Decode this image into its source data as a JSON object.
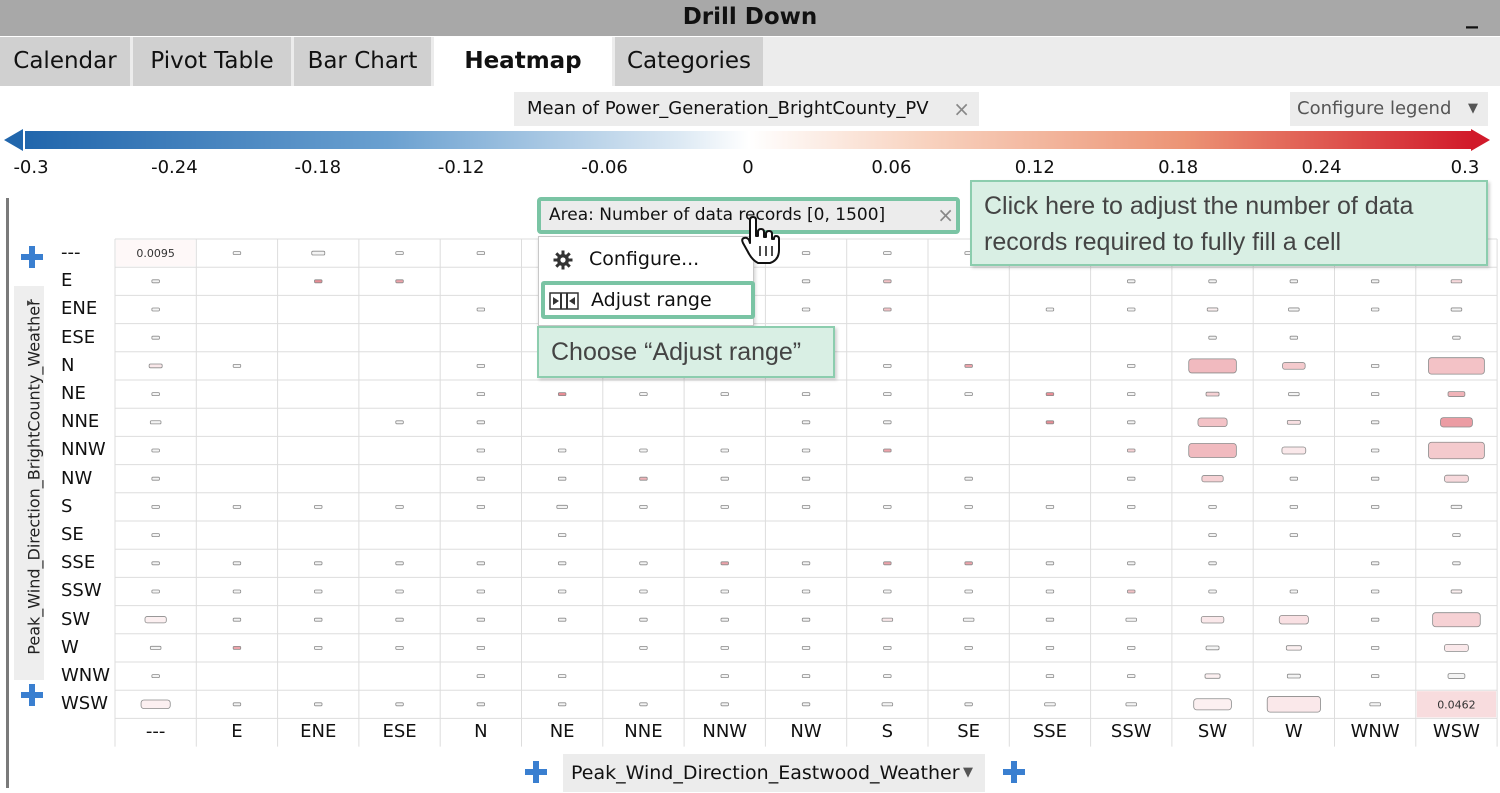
{
  "window": {
    "title": "Drill Down",
    "minimize_label": "_"
  },
  "tabs": [
    {
      "label": "Calendar",
      "active": false
    },
    {
      "label": "Pivot Table",
      "active": false
    },
    {
      "label": "Bar Chart",
      "active": false
    },
    {
      "label": "Heatmap",
      "active": true
    },
    {
      "label": "Categories",
      "active": false
    }
  ],
  "measure": {
    "label": "Mean of Power_Generation_BrightCounty_PV",
    "remove_glyph": "×"
  },
  "legend_dropdown": {
    "label": "Configure legend"
  },
  "color_scale": {
    "min": -0.3,
    "max": 0.3,
    "ticks": [
      "-0.3",
      "-0.24",
      "-0.18",
      "-0.12",
      "-0.06",
      "0",
      "0.06",
      "0.12",
      "0.18",
      "0.24",
      "0.3"
    ],
    "low_color": "#2166ac",
    "mid_color": "#ffffff",
    "high_color": "#d11a2a"
  },
  "area_encoding": {
    "label": "Area:  Number of data records  [0, 1500]",
    "remove_glyph": "×"
  },
  "context_menu": {
    "items": [
      {
        "label": "Configure...",
        "icon": "gear-icon"
      },
      {
        "label": "Adjust range",
        "icon": "adjust-range-icon"
      }
    ]
  },
  "callouts": [
    "Click here to adjust the number of data records required to fully fill a cell",
    "Choose “Adjust range”"
  ],
  "y_axis": {
    "title": "Peak_Wind_Direction_BrightCounty_Weather",
    "categories": [
      "---",
      "E",
      "ENE",
      "ESE",
      "N",
      "NE",
      "NNE",
      "NNW",
      "NW",
      "S",
      "SE",
      "SSE",
      "SSW",
      "SW",
      "W",
      "WNW",
      "WSW"
    ]
  },
  "x_axis": {
    "title": "Peak_Wind_Direction_Eastwood_Weather",
    "categories": [
      "---",
      "E",
      "ENE",
      "ESE",
      "N",
      "NE",
      "NNE",
      "NNW",
      "NW",
      "S",
      "SE",
      "SSE",
      "SSW",
      "SW",
      "W",
      "WNW",
      "WSW"
    ]
  },
  "chart_data": {
    "type": "heatmap",
    "x_categories": [
      "---",
      "E",
      "ENE",
      "ESE",
      "N",
      "NE",
      "NNE",
      "NNW",
      "NW",
      "S",
      "SE",
      "SSE",
      "SSW",
      "SW",
      "W",
      "WNW",
      "WSW"
    ],
    "y_categories": [
      "---",
      "E",
      "ENE",
      "ESE",
      "N",
      "NE",
      "NNE",
      "NNW",
      "NW",
      "S",
      "SE",
      "SSE",
      "SSW",
      "SW",
      "W",
      "WNW",
      "WSW"
    ],
    "color_range": [
      -0.3,
      0.3
    ],
    "area_range": [
      0,
      1500
    ],
    "cell_labels": [
      {
        "x": "---",
        "y": "---",
        "label": "0.0095"
      },
      {
        "x": "WSW",
        "y": "WSW",
        "label": "0.0462"
      }
    ],
    "rows": [
      [
        "f:1:0.0095",
        "d:0.01:0",
        "d:0.03:0",
        "d:0.01:0",
        "d:0.01:0",
        "",
        "",
        "",
        "d:0.01:0",
        "d:0.01:0",
        "d:0.01:0",
        "",
        "",
        "",
        "",
        "",
        ""
      ],
      [
        "d:0.01:0",
        "",
        "d:0.01:0.15",
        "d:0.01:0.12",
        "",
        "",
        "",
        "",
        "d:0.01:0",
        "d:0.01:0.08",
        "",
        "",
        "d:0.01:0",
        "d:0.01:0",
        "d:0.01:0",
        "d:0.01:0",
        "d:0.02:0.05"
      ],
      [
        "d:0.01:0",
        "",
        "",
        "",
        "d:0.01:0",
        "",
        "",
        "",
        "d:0.01:0",
        "d:0.01:0.08",
        "",
        "d:0.01:0",
        "d:0.01:0",
        "d:0.02:0.02",
        "d:0.02:0",
        "d:0.01:0",
        "d:0.02:0"
      ],
      [
        "d:0.01:0",
        "",
        "",
        "",
        "",
        "",
        "",
        "",
        "",
        "",
        "",
        "",
        "",
        "d:0.01:0",
        "d:0.01:0",
        "",
        "d:0.01:0"
      ],
      [
        "d:0.03:0.03",
        "d:0.01:0",
        "",
        "",
        "d:0.01:0",
        "",
        "",
        "",
        "d:0.01:0",
        "d:0.01:0",
        "d:0.01:0.12",
        "",
        "d:0.01:0",
        "d:0.4:0.09",
        "d:0.09:0.07",
        "d:0.01:0",
        "d:0.55:0.08"
      ],
      [
        "d:0.01:0",
        "",
        "",
        "",
        "d:0.01:0",
        "d:0.01:0.15",
        "d:0.01:0",
        "d:0.01:0",
        "d:0.01:0",
        "d:0.01:0",
        "d:0.01:0",
        "d:0.01:0.15",
        "d:0.01:0",
        "d:0.03:0.06",
        "d:0.02:0",
        "d:0.01:0",
        "d:0.05:0.1"
      ],
      [
        "d:0.02:0",
        "",
        "",
        "d:0.01:0",
        "d:0.01:0",
        "",
        "",
        "",
        "d:0.01:0",
        "d:0.01:0",
        "",
        "d:0.01:0.15",
        "d:0.01:0",
        "d:0.15:0.08",
        "d:0.03:0.04",
        "d:0.01:0",
        "d:0.18:0.13"
      ],
      [
        "d:0.01:0",
        "",
        "",
        "",
        "d:0.01:0",
        "d:0.01:0",
        "d:0.01:0",
        "d:0.01:0",
        "d:0.01:0",
        "d:0.01:0.12",
        "",
        "",
        "d:0.01:0.06",
        "d:0.4:0.09",
        "d:0.1:0.03",
        "d:0.01:0",
        "d:0.55:0.07"
      ],
      [
        "d:0.01:0",
        "",
        "",
        "",
        "d:0.01:0",
        "d:0.01:0",
        "d:0.01:0.1",
        "d:0.01:0",
        "d:0.01:0",
        "",
        "d:0.01:0",
        "",
        "d:0.01:0",
        "d:0.08:0.06",
        "d:0.01:0",
        "d:0.01:0",
        "d:0.1:0.05"
      ],
      [
        "d:0.01:0",
        "d:0.01:0",
        "d:0.01:0",
        "d:0.01:0",
        "d:0.01:0",
        "d:0.02:0",
        "d:0.01:0",
        "d:0.01:0",
        "d:0.01:0",
        "d:0.01:0",
        "d:0.01:0",
        "d:0.01:0",
        "d:0.01:0",
        "d:0.01:0",
        "d:0.01:0",
        "d:0.01:0",
        "d:0.02:0"
      ],
      [
        "d:0.01:0",
        "",
        "",
        "",
        "",
        "d:0.01:0",
        "",
        "",
        "",
        "",
        "",
        "",
        "",
        "d:0.01:0",
        "d:0.01:0",
        "",
        "d:0.01:0"
      ],
      [
        "d:0.01:0",
        "d:0.01:0",
        "d:0.01:0",
        "d:0.01:0",
        "d:0.01:0",
        "d:0.01:0",
        "d:0.01:0",
        "d:0.01:0.12",
        "d:0.01:0",
        "d:0.01:0.12",
        "d:0.01:0.12",
        "d:0.01:0",
        "d:0.01:0",
        "d:0.01:0",
        "",
        "d:0.01:0",
        "d:0.01:0"
      ],
      [
        "d:0.01:0",
        "d:0.01:0",
        "d:0.01:0",
        "d:0.01:0",
        "d:0.01:0",
        "d:0.01:0",
        "d:0.01:0",
        "d:0.01:0",
        "d:0.01:0",
        "d:0.01:0",
        "d:0.01:0",
        "d:0.01:0",
        "d:0.01:0.08",
        "d:0.01:0",
        "d:0.01:0",
        "d:0.01:0",
        "d:0.02:0.02"
      ],
      [
        "d:0.08:0.02",
        "d:0.01:0",
        "d:0.01:0",
        "d:0.01:0",
        "d:0.01:0",
        "d:0.01:0",
        "d:0.01:0",
        "d:0.01:0",
        "d:0.01:0",
        "d:0.02:0.03",
        "d:0.02:0",
        "d:0.01:0",
        "d:0.02:0",
        "d:0.09:0.03",
        "d:0.15:0.04",
        "d:0.01:0",
        "d:0.4:0.06"
      ],
      [
        "d:0.02:0",
        "d:0.01:0.12",
        "d:0.01:0",
        "d:0.01:0",
        "d:0.01:0",
        "",
        "d:0.01:0",
        "d:0.01:0",
        "d:0.01:0",
        "d:0.01:0",
        "d:0.01:0",
        "d:0.01:0",
        "d:0.01:0",
        "d:0.03:0",
        "d:0.04:0.02",
        "d:0.01:0",
        "d:0.1:0.03"
      ],
      [
        "d:0.01:0",
        "",
        "",
        "",
        "d:0.01:0",
        "d:0.01:0",
        "",
        "d:0.01:0",
        "d:0.01:0",
        "d:0.01:0",
        "",
        "d:0.01:0",
        "d:0.01:0",
        "d:0.04:0.02",
        "d:0.03:0",
        "d:0.01:0",
        "d:0.05:0"
      ],
      [
        "d:0.15:0.02",
        "d:0.01:0",
        "d:0.01:0",
        "d:0.01:0",
        "d:0.01:0",
        "d:0.01:0",
        "d:0.01:0",
        "d:0.01:0",
        "d:0.01:0",
        "d:0.02:0",
        "d:0.01:0",
        "d:0.02:0",
        "d:0.02:0",
        "d:0.25:0.02",
        "d:0.5:0.03",
        "d:0.02:0",
        "f:1:0.0462"
      ]
    ]
  }
}
